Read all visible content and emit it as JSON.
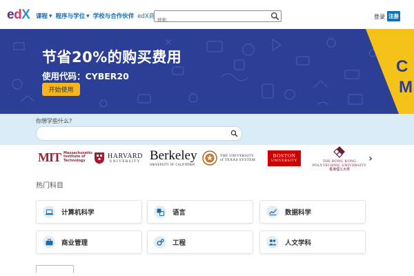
{
  "header": {
    "logo": {
      "e": "e",
      "d": "d",
      "x": "X"
    },
    "nav": {
      "courses": "课程",
      "programs": "程序与学位",
      "partners": "学校与合作伙伴",
      "business": "edX商业版"
    },
    "search_placeholder": "搜索:",
    "login": "登录",
    "register": "注册"
  },
  "banner": {
    "title": "节省20%的购买费用",
    "code": "使用代码：CYBER20",
    "button": "开始使用",
    "bg_color": "#2b3f96",
    "button_color": "#f9b517",
    "corner_color": "#f5c21a"
  },
  "search": {
    "label": "你想学些什么?",
    "value": ""
  },
  "partners": {
    "mit": {
      "mark": "MIT",
      "line1": "Massachusetts",
      "line2": "Institute of",
      "line3": "Technology"
    },
    "harvard": {
      "line1": "HARVARD",
      "line2": "UNIVERSITY"
    },
    "berkeley": {
      "line1": "Berkeley",
      "line2": "UNIVERSITY OF CALIFORNIA"
    },
    "texas": {
      "line1": "THE UNIVERSITY",
      "line2": "of TEXAS SYSTEM"
    },
    "boston": {
      "line1": "BOSTON",
      "line2": "UNIVERSITY"
    },
    "polyu": {
      "line1": "THE HONG KONG",
      "line2": "POLYTECHNIC UNIVERSITY",
      "line3": "香港理工大學"
    },
    "next_icon": "chevron-right-icon"
  },
  "subjects": {
    "title": "热门科目",
    "items": [
      {
        "label": "计算机科学",
        "icon": "laptop-icon"
      },
      {
        "label": "语言",
        "icon": "translate-icon"
      },
      {
        "label": "数据科学",
        "icon": "chart-icon"
      },
      {
        "label": "商业管理",
        "icon": "briefcase-icon"
      },
      {
        "label": "工程",
        "icon": "gears-icon"
      },
      {
        "label": "人文学科",
        "icon": "people-icon"
      }
    ]
  }
}
